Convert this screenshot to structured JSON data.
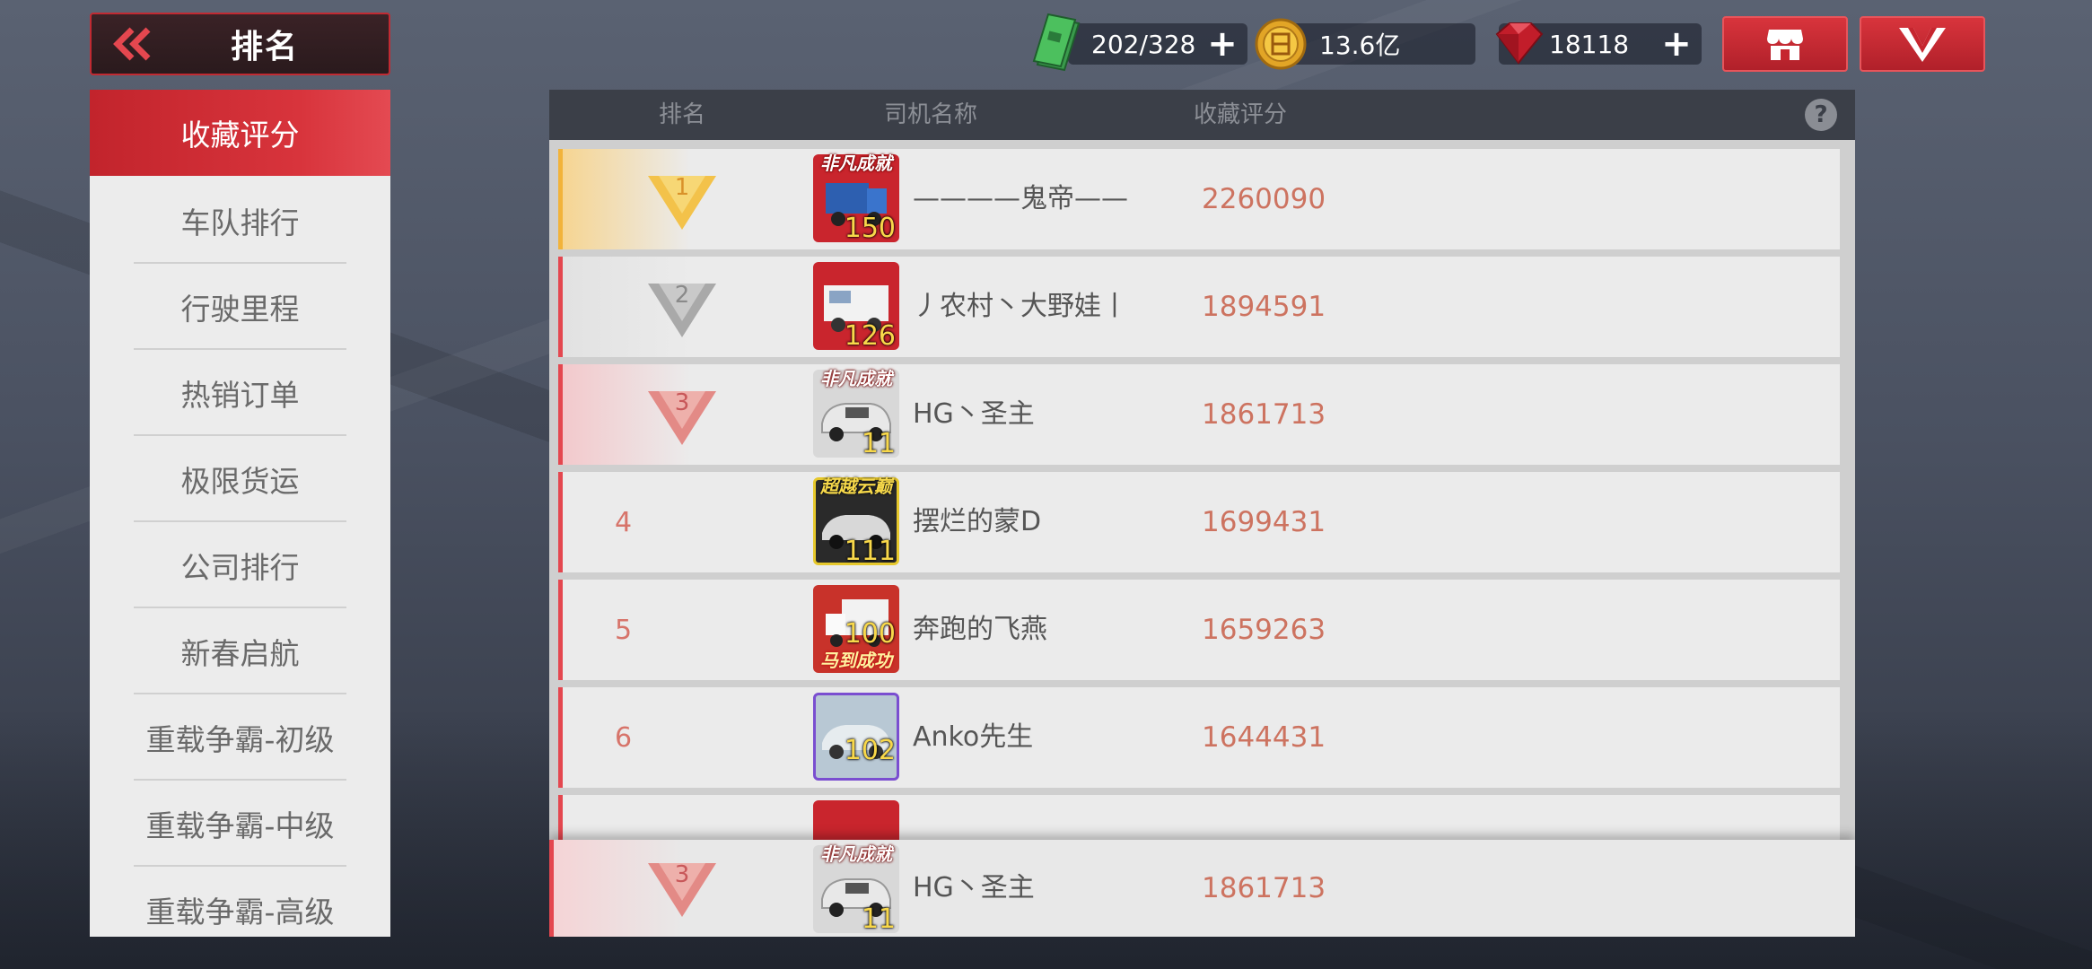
{
  "header": {
    "title": "排名",
    "resources": [
      {
        "icon": "cash-stack-icon",
        "value": "202/328",
        "addable": true
      },
      {
        "icon": "gold-coin-icon",
        "value": "13.6亿",
        "addable": false
      },
      {
        "icon": "ruby-gem-icon",
        "value": "18118",
        "addable": true
      }
    ],
    "plus_label": "+",
    "shop_icon": "shop-icon",
    "vip_icon": "vip-icon"
  },
  "sidebar": {
    "items": [
      {
        "label": "收藏评分",
        "active": true
      },
      {
        "label": "车队排行"
      },
      {
        "label": "行驶里程"
      },
      {
        "label": "热销订单"
      },
      {
        "label": "极限货运"
      },
      {
        "label": "公司排行"
      },
      {
        "label": "新春启航"
      },
      {
        "label": "重载争霸-初级"
      },
      {
        "label": "重载争霸-中级"
      },
      {
        "label": "重载争霸-高级"
      }
    ]
  },
  "table": {
    "columns": [
      "排名",
      "司机名称",
      "收藏评分"
    ],
    "help": "?",
    "rows": [
      {
        "rank": "1",
        "name": "————鬼帝——",
        "score": "2260090",
        "level": "150",
        "tag": "非凡成就",
        "theme": "blue"
      },
      {
        "rank": "2",
        "name": "丿农村丶大野娃丨",
        "score": "1894591",
        "level": "126",
        "tag": "",
        "theme": "white"
      },
      {
        "rank": "3",
        "name": "HG丶圣主",
        "score": "1861713",
        "level": "11",
        "tag": "非凡成就",
        "theme": "silver"
      },
      {
        "rank": "4",
        "name": "摆烂的蒙D",
        "score": "1699431",
        "level": "111",
        "tag": "超越云巅",
        "theme": "dark"
      },
      {
        "rank": "5",
        "name": "奔跑的飞燕",
        "score": "1659263",
        "level": "100",
        "tag": "马到成功",
        "theme": "box"
      },
      {
        "rank": "6",
        "name": "Anko先生",
        "score": "1644431",
        "level": "102",
        "tag": "",
        "theme": "purple"
      }
    ],
    "self": {
      "rank": "3",
      "name": "HG丶圣主",
      "score": "1861713",
      "level": "11",
      "tag": "非凡成就"
    }
  },
  "colors": {
    "accent_red": "#d8343c",
    "gold": "#f2b33a",
    "score": "#cd7360"
  }
}
